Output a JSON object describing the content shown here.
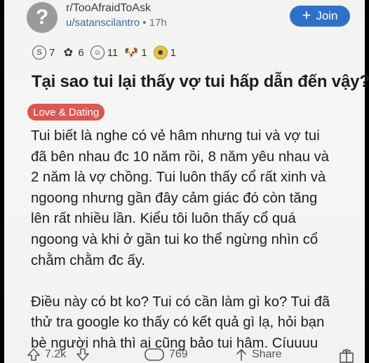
{
  "header": {
    "subreddit": "r/TooAfraidToAsk",
    "author": "u/satanscilantro",
    "separator": "•",
    "age": "17h",
    "join_label": "Join",
    "join_plus": "+",
    "avatar_glyph": "?"
  },
  "awards": [
    {
      "icon": "silver-award-icon",
      "glyph": "S",
      "count": "7"
    },
    {
      "icon": "helpful-award-icon",
      "glyph": "✿",
      "count": "6"
    },
    {
      "icon": "wholesome-award-icon",
      "glyph": "☺",
      "count": "11"
    },
    {
      "icon": "dog-award-icon",
      "glyph": "🐶",
      "count": "1"
    },
    {
      "icon": "gold-award-icon",
      "glyph": "☻",
      "count": "1"
    }
  ],
  "post": {
    "title": "Tại sao tui lại thấy vợ tui hấp dẫn đến vậy?",
    "flair": "Love & Dating",
    "body_lines": [
      "Tui biết là nghe có vẻ hâm nhưng tui và vợ tui",
      "đã bên nhau đc 10 năm rồi, 8 năm yêu nhau và",
      "2 năm là vợ chồng. Tui luôn thấy cổ rất xinh và",
      "ngoong nhưng gần đây cảm giác đó còn tăng",
      "lên rất nhiều lần. Kiểu tôi luôn thấy cổ quá",
      "ngoong và khi ở gần tui ko thể ngừng nhìn cổ",
      "chằm chằm đc ấy.",
      "",
      "Điều này có bt ko? Tui có cần làm gì ko? Tui đã",
      "thử tra google ko thấy có kết quả gì lạ, hỏi bạn",
      "bè người nhà thì ai cũng bảo tui hâm. Cíuuuu"
    ]
  },
  "footer": {
    "upvotes": "7.2k",
    "comments": "769",
    "share_label": "Share"
  },
  "colors": {
    "accent": "#2f71c8",
    "flair": "#dc5654",
    "username": "#3e6c98"
  }
}
